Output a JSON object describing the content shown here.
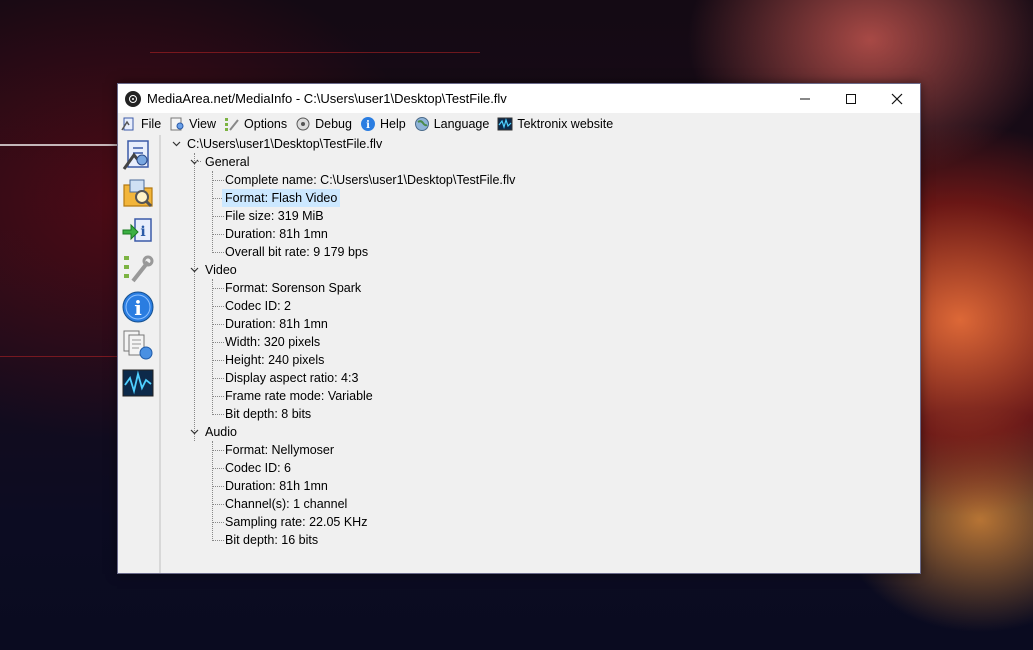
{
  "window": {
    "title": "MediaArea.net/MediaInfo - C:\\Users\\user1\\Desktop\\TestFile.flv",
    "minimize_glyph": "minimize",
    "maximize_glyph": "maximize",
    "close_glyph": "close"
  },
  "menu": [
    {
      "label": "File",
      "icon": "file-icon"
    },
    {
      "label": "View",
      "icon": "view-icon"
    },
    {
      "label": "Options",
      "icon": "options-icon"
    },
    {
      "label": "Debug",
      "icon": "debug-icon"
    },
    {
      "label": "Help",
      "icon": "help-icon"
    },
    {
      "label": "Language",
      "icon": "language-icon"
    },
    {
      "label": "Tektronix website",
      "icon": "tektronix-icon"
    }
  ],
  "sidebar": [
    {
      "icon": "open-file-icon"
    },
    {
      "icon": "open-folder-icon"
    },
    {
      "icon": "export-icon"
    },
    {
      "icon": "preferences-icon"
    },
    {
      "icon": "about-icon"
    },
    {
      "icon": "knowledge-icon"
    },
    {
      "icon": "tektronix-wave-icon"
    }
  ],
  "tree": {
    "root": "C:\\Users\\user1\\Desktop\\TestFile.flv",
    "sections": [
      {
        "name": "General",
        "items": [
          "Complete name: C:\\Users\\user1\\Desktop\\TestFile.flv",
          "Format: Flash Video",
          "File size: 319 MiB",
          "Duration: 81h 1mn",
          "Overall bit rate: 9 179 bps"
        ]
      },
      {
        "name": "Video",
        "items": [
          "Format: Sorenson Spark",
          "Codec ID: 2",
          "Duration: 81h 1mn",
          "Width: 320 pixels",
          "Height: 240 pixels",
          "Display aspect ratio: 4:3",
          "Frame rate mode: Variable",
          "Bit depth: 8 bits"
        ]
      },
      {
        "name": "Audio",
        "items": [
          "Format: Nellymoser",
          "Codec ID: 6",
          "Duration: 81h 1mn",
          "Channel(s): 1 channel",
          "Sampling rate: 22.05 KHz",
          "Bit depth: 16 bits"
        ]
      }
    ],
    "selected": "Format: Flash Video"
  }
}
